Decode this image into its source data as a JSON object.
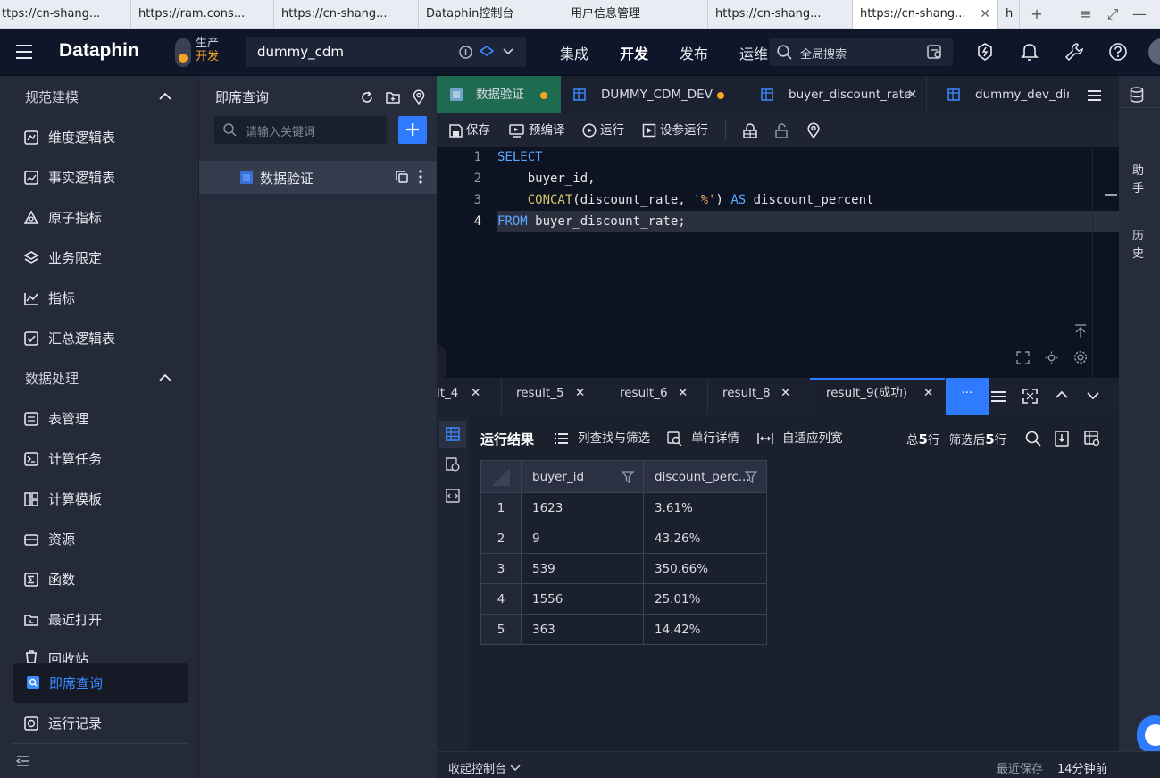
{
  "browser": {
    "tabs": [
      {
        "label": "ttps://cn-shang..."
      },
      {
        "label": "https://ram.cons..."
      },
      {
        "label": "https://cn-shang..."
      },
      {
        "label": "Dataphin控制台"
      },
      {
        "label": "用户信息管理"
      },
      {
        "label": "https://cn-shang..."
      },
      {
        "label": "https://cn-shang..."
      },
      {
        "label": "h"
      }
    ]
  },
  "header": {
    "logo": "Dataphin",
    "env_top": "生产",
    "env_bottom": "开发",
    "project": "dummy_cdm",
    "nav": [
      "集成",
      "开发",
      "发布",
      "运维"
    ],
    "search_placeholder": "全局搜索"
  },
  "sidebar": {
    "group1": "规范建模",
    "group1_items": [
      "维度逻辑表",
      "事实逻辑表",
      "原子指标",
      "业务限定",
      "指标",
      "汇总逻辑表"
    ],
    "group2": "数据处理",
    "group2_items": [
      "表管理",
      "计算任务",
      "计算模板",
      "资源",
      "函数",
      "最近打开",
      "回收站",
      "即席查询",
      "运行记录"
    ]
  },
  "explorer": {
    "title": "即席查询",
    "search_placeholder": "请输入关键词",
    "file": "数据验证"
  },
  "editor": {
    "tabs": [
      {
        "label": "数据验证"
      },
      {
        "label": "DUMMY_CDM_DEV"
      },
      {
        "label": "buyer_discount_rate"
      },
      {
        "label": "dummy_dev_din"
      }
    ],
    "toolbar": {
      "save": "保存",
      "precompile": "预编译",
      "run": "运行",
      "run_with_params": "设参运行"
    },
    "line_numbers": [
      "1",
      "2",
      "3",
      "4"
    ],
    "code": {
      "l1_kw": "SELECT",
      "l2": "    buyer_id,",
      "l3_indent": "    ",
      "l3_fn": "CONCAT",
      "l3_mid": "(discount_rate, ",
      "l3_str": "'%'",
      "l3_close": ") ",
      "l3_as": "AS",
      "l3_end": " discount_percent",
      "l4_kw": "FROM",
      "l4_end": " buyer_discount_rate;"
    }
  },
  "right_rail": {
    "assistant": [
      "助",
      "手"
    ],
    "history": [
      "历",
      "史"
    ]
  },
  "results": {
    "tabs": [
      "lt_4",
      "result_5",
      "result_6",
      "result_8",
      "result_9(成功)"
    ],
    "more": "···",
    "title": "运行结果",
    "column_filter": "列查找与筛选",
    "row_detail": "单行详情",
    "auto_width": "自适应列宽",
    "total_prefix": "总",
    "total_count": "5",
    "total_suffix": "行",
    "filtered_prefix": "筛选后",
    "filtered_count": "5",
    "filtered_suffix": "行",
    "columns": [
      "buyer_id",
      "discount_perc..."
    ],
    "rows": [
      [
        "1",
        "1623",
        "3.61%"
      ],
      [
        "2",
        "9",
        "43.26%"
      ],
      [
        "3",
        "539",
        "350.66%"
      ],
      [
        "4",
        "1556",
        "25.01%"
      ],
      [
        "5",
        "363",
        "14.42%"
      ]
    ]
  },
  "status_bar": {
    "collapse_console": "收起控制台",
    "last_saved_label": "最近保存",
    "last_saved_value": "14分钟前"
  },
  "colors": {
    "accent": "#2f7bff",
    "env_dot": "#f5a623",
    "active_editor_tab": "#1e6b52"
  }
}
